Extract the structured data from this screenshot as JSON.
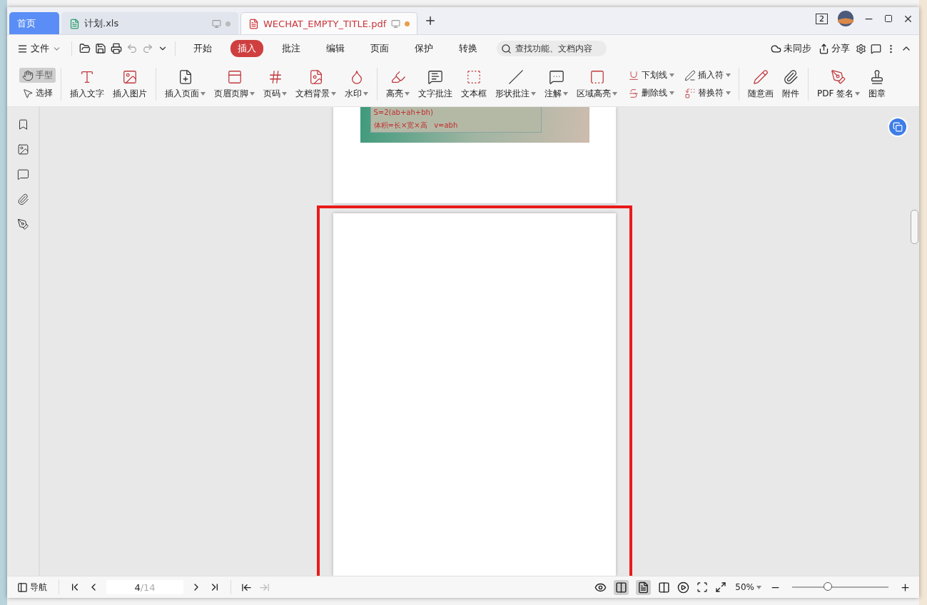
{
  "tabs": [
    {
      "label": "首页",
      "kind": "home",
      "selected": false
    },
    {
      "label": "计划.xls",
      "kind": "sheet",
      "selected": false,
      "modified": false
    },
    {
      "label": "WECHAT_EMPTY_TITLE.pdf",
      "kind": "pdf",
      "selected": true,
      "modified": true
    }
  ],
  "window_count": "2",
  "menu": {
    "file": "文件",
    "ribbon_tabs": [
      {
        "label": "开始",
        "selected": false
      },
      {
        "label": "插入",
        "selected": true
      },
      {
        "label": "批注",
        "selected": false
      },
      {
        "label": "编辑",
        "selected": false
      },
      {
        "label": "页面",
        "selected": false
      },
      {
        "label": "保护",
        "selected": false
      },
      {
        "label": "转换",
        "selected": false
      }
    ],
    "search": {
      "placeholder": "查找功能、文档内容"
    },
    "sync": "未同步",
    "share": "分享"
  },
  "tool_groups": [
    {
      "kind": "stack",
      "tools": [
        {
          "label": "手型",
          "kind": "hand",
          "selected": true,
          "dropdown": false
        },
        {
          "label": "选择",
          "kind": "pointer",
          "selected": false,
          "dropdown": false
        }
      ]
    },
    {
      "kind": "row",
      "tools": [
        {
          "label": "插入文字",
          "kind": "text",
          "dropdown": false
        },
        {
          "label": "插入图片",
          "kind": "image",
          "dropdown": false
        }
      ]
    },
    {
      "kind": "row",
      "tools": [
        {
          "label": "插入页面",
          "kind": "addpage",
          "dropdown": true
        },
        {
          "label": "页眉页脚",
          "kind": "header",
          "dropdown": true
        },
        {
          "label": "页码",
          "kind": "pagenumber",
          "dropdown": true
        },
        {
          "label": "文档背景",
          "kind": "background",
          "dropdown": true
        },
        {
          "label": "水印",
          "kind": "watermark",
          "dropdown": true
        }
      ]
    },
    {
      "kind": "row",
      "tools": [
        {
          "label": "高亮",
          "kind": "highlight",
          "dropdown": true
        },
        {
          "label": "文字批注",
          "kind": "textnote",
          "dropdown": false
        },
        {
          "label": "文本框",
          "kind": "textbox",
          "dropdown": false
        },
        {
          "label": "形状批注",
          "kind": "line",
          "dropdown": true
        },
        {
          "label": "注解",
          "kind": "comment",
          "dropdown": true
        },
        {
          "label": "区域高亮",
          "kind": "area",
          "dropdown": true
        }
      ]
    },
    {
      "kind": "stack",
      "tools": [
        {
          "label": "下划线",
          "kind": "underline",
          "dropdown": true
        },
        {
          "label": "删除线",
          "kind": "strike",
          "dropdown": true
        }
      ]
    },
    {
      "kind": "stack",
      "tools": [
        {
          "label": "插入符",
          "kind": "caret",
          "dropdown": true
        },
        {
          "label": "替换符",
          "kind": "replace",
          "dropdown": true
        }
      ]
    },
    {
      "kind": "row",
      "tools": [
        {
          "label": "随意画",
          "kind": "pencil",
          "dropdown": false
        },
        {
          "label": "附件",
          "kind": "clip",
          "dropdown": false
        }
      ]
    },
    {
      "kind": "row",
      "tools": [
        {
          "label": "PDF 签名",
          "kind": "sign",
          "dropdown": true
        },
        {
          "label": "图章",
          "kind": "stamp",
          "dropdown": false
        }
      ]
    }
  ],
  "document": {
    "figure_lines": [
      "S=2(ab+ah+bh)",
      "体积=长×宽×高   v=abh"
    ],
    "highlighted_page": true
  },
  "status_bar": {
    "nav": "导航",
    "page_current": "4",
    "page_total": "/14",
    "zoom": "50%",
    "zoom_slider": {
      "level": 0.37
    }
  }
}
